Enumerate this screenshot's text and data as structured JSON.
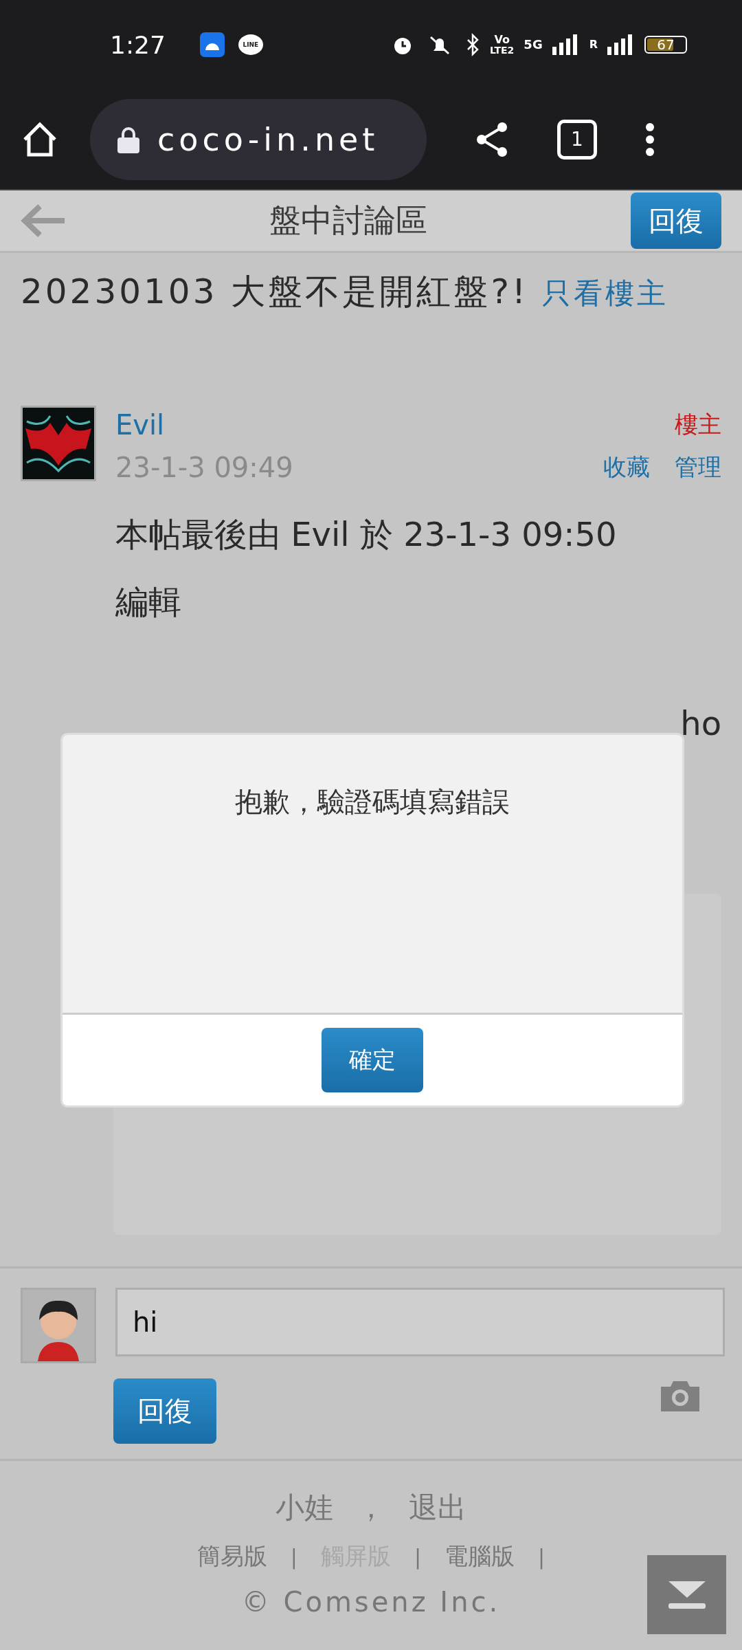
{
  "status_bar": {
    "time": "1:27",
    "line_logo": "LINE",
    "volte": "Vo",
    "lte": "LTE2",
    "network": "5G",
    "roaming": "R",
    "battery": "67"
  },
  "browser": {
    "url": "coco-in.net",
    "tab_count": "1"
  },
  "header": {
    "title": "盤中討論區",
    "reply_button": "回復"
  },
  "thread": {
    "title": "20230103 大盤不是開紅盤?!",
    "filter_link": "只看樓主"
  },
  "post": {
    "author": "Evil",
    "badge": "樓主",
    "time": "23-1-3 09:49",
    "actions": [
      "收藏",
      "管理"
    ],
    "body": "本帖最後由 Evil 於 23-1-3 09:50 編輯",
    "partial_line": "ho"
  },
  "dialog": {
    "message": "抱歉，驗證碼填寫錯誤",
    "button": "確定"
  },
  "reply": {
    "value": "hi",
    "button": "回復"
  },
  "footer": {
    "user": "小娃",
    "separator": "，",
    "logout": "退出",
    "versions": [
      {
        "label": "簡易版",
        "current": false,
        "divider": "|"
      },
      {
        "label": "觸屏版",
        "current": true,
        "divider": "|"
      },
      {
        "label": "電腦版",
        "current": false,
        "divider": "|"
      }
    ],
    "copyright": "© Comsenz Inc."
  }
}
